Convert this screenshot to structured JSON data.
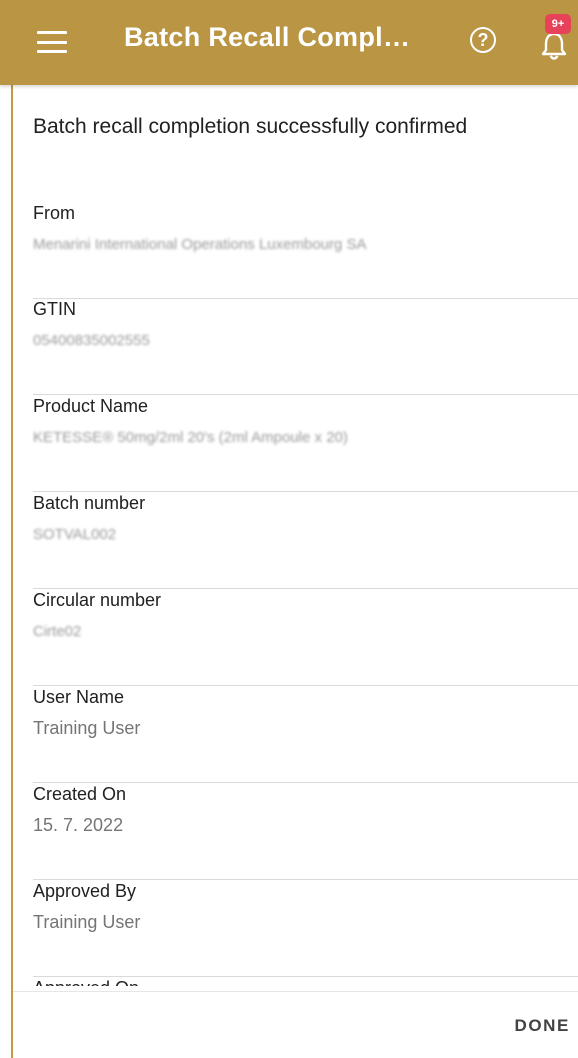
{
  "app_bar": {
    "title": "Batch Recall Compl…",
    "help_symbol": "?",
    "notification_badge": "9+",
    "background_color": "#b99544"
  },
  "message": "Batch recall completion successfully confirmed",
  "fields": [
    {
      "label": "From",
      "value": "Menarini International Operations Luxembourg SA",
      "blurred": true
    },
    {
      "label": "GTIN",
      "value": "05400835002555",
      "blurred": true
    },
    {
      "label": "Product Name",
      "value": "KETESSE® 50mg/2ml 20's (2ml Ampoule x 20)",
      "blurred": true
    },
    {
      "label": "Batch number",
      "value": "SOTVAL002",
      "blurred": true
    },
    {
      "label": "Circular number",
      "value": "Cirte02",
      "blurred": true
    },
    {
      "label": "User Name",
      "value": "Training User",
      "blurred": false
    },
    {
      "label": "Created On",
      "value": "15. 7. 2022",
      "blurred": false
    },
    {
      "label": "Approved By",
      "value": "Training User",
      "blurred": false
    },
    {
      "label": "Approved On",
      "value": "",
      "blurred": false
    }
  ],
  "footer": {
    "done_label": "DONE"
  }
}
